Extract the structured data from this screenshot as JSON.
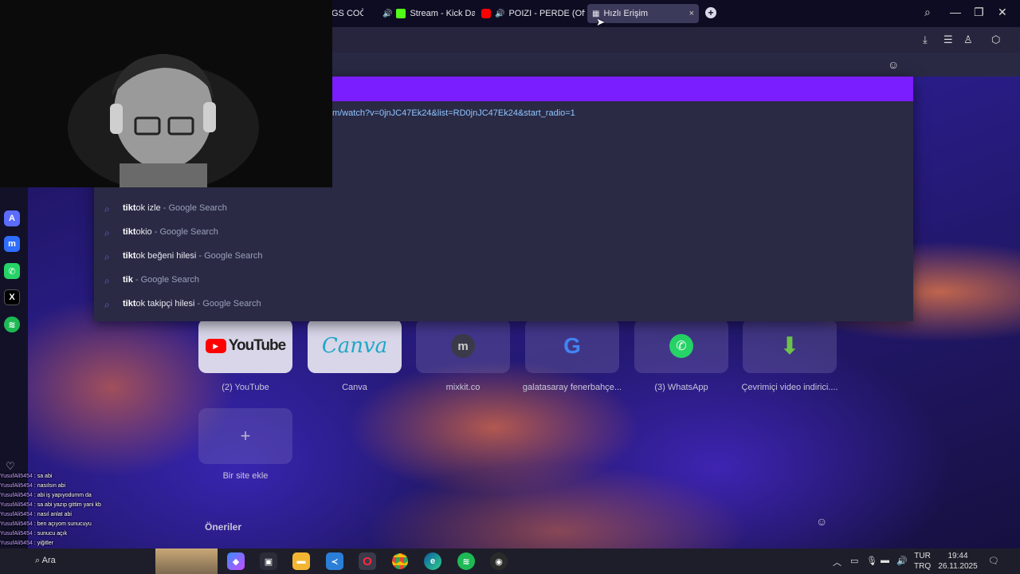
{
  "browser": {
    "tabs": [
      {
        "label": "GS COĞ",
        "type": "partial"
      },
      {
        "label": "Stream - Kick Dashboa",
        "audio": true,
        "brand_color": "#53fc18"
      },
      {
        "label": "POIZI - PERDE (Officia",
        "audio": true,
        "brand_color": "#ff0000"
      },
      {
        "label": "Hızlı Erişim",
        "active": true
      }
    ],
    "new_tab_label": "+",
    "close_tab_label": "×"
  },
  "omnibox": {
    "url_fragment": "m/watch?v=0jnJC47Ek24&list=RD0jnJC47Ek24&start_radio=1",
    "suggestions": [
      {
        "bold": "tikt",
        "rest": "ok izle",
        "source": " - Google Search"
      },
      {
        "bold": "tikt",
        "rest": "okio",
        "source": " - Google Search"
      },
      {
        "bold": "tikt",
        "rest": "ok beğeni hilesi",
        "source": " - Google Search"
      },
      {
        "bold": "tik",
        "rest": "",
        "source": " - Google Search"
      },
      {
        "bold": "tikt",
        "rest": "ok takipçi hilesi",
        "source": " - Google Search"
      }
    ],
    "partial_suggestion": "tiktok izle - Google Search"
  },
  "speed_dial": {
    "tiles": [
      {
        "label": "(2) YouTube",
        "logo": "YouTube"
      },
      {
        "label": "Canva",
        "logo": "Canva"
      },
      {
        "label": "mixkit.co",
        "logo": "m"
      },
      {
        "label": "galatasaray fenerbahçe...",
        "logo": "G"
      },
      {
        "label": "(3) WhatsApp",
        "logo": "whatsapp-icon"
      },
      {
        "label": "Çevrimiçi video indirici....",
        "logo": "download-arrow-icon"
      }
    ],
    "add_site_label": "Bir site ekle",
    "suggestions_heading": "Öneriler"
  },
  "chat": [
    {
      "user": "YusufAli5454",
      "msg": "sa abi"
    },
    {
      "user": "YusufAli5454",
      "msg": "nasılsın abi"
    },
    {
      "user": "YusufAli5454",
      "msg": "abi iş yapıyodumm da"
    },
    {
      "user": "YusufAli5454",
      "msg": "sa abi yazıp gittim yani kb"
    },
    {
      "user": "YusufAli5454",
      "msg": "nasıl anlat abi"
    },
    {
      "user": "YusufAli5454",
      "msg": "ben açıyom sunucuyu"
    },
    {
      "user": "YusufAli5454",
      "msg": "sunucu açık"
    },
    {
      "user": "YusufAli5454",
      "msg": "yiğitler"
    }
  ],
  "taskbar": {
    "search_label": "Ara",
    "lang_top": "TUR",
    "lang_bottom": "TRQ",
    "time": "19:44",
    "date": "26.11.2025"
  },
  "colors": {
    "accent": "#7a1dff",
    "kick": "#53fc18",
    "youtube": "#ff0000",
    "whatsapp": "#25d366",
    "spotify": "#1db954"
  }
}
